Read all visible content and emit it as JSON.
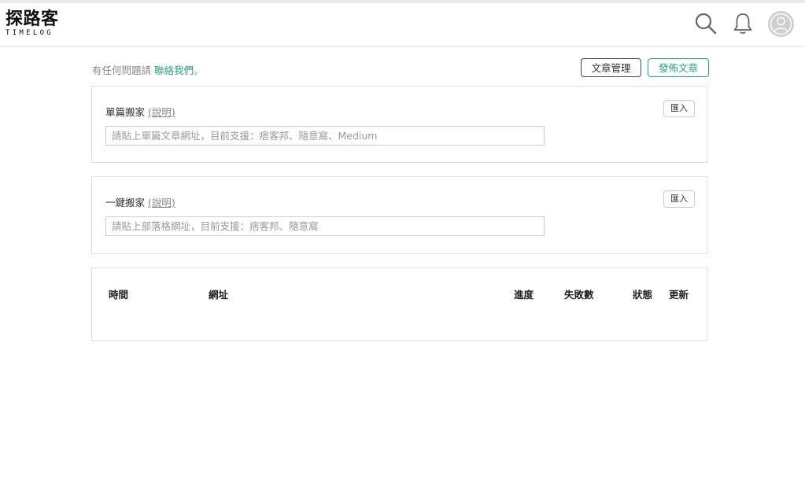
{
  "header": {
    "logo_cn": "探路客",
    "logo_en": "TIMELOG",
    "icons": [
      "search-icon",
      "bell-icon",
      "avatar"
    ]
  },
  "contact": {
    "prefix": "有任何問題請 ",
    "link": "聯絡我們",
    "suffix": "。"
  },
  "actions": {
    "manage_label": "文章管理",
    "publish_label": "發佈文章"
  },
  "single_import": {
    "title": "單篇搬家",
    "help": "(說明)",
    "button": "匯入",
    "placeholder": "請貼上單篇文章網址，目前支援：痞客邦、隨意窩、Medium"
  },
  "bulk_import": {
    "title": "一鍵搬家",
    "help": "(說明)",
    "button": "匯入",
    "placeholder": "請貼上部落格網址，目前支援：痞客邦、隨意窩"
  },
  "table": {
    "headers": [
      "時間",
      "網址",
      "進度",
      "失敗數",
      "狀態",
      "更新"
    ],
    "rows": []
  },
  "colors": {
    "accent": "#2aa37a",
    "border": "#e0e0e0"
  }
}
